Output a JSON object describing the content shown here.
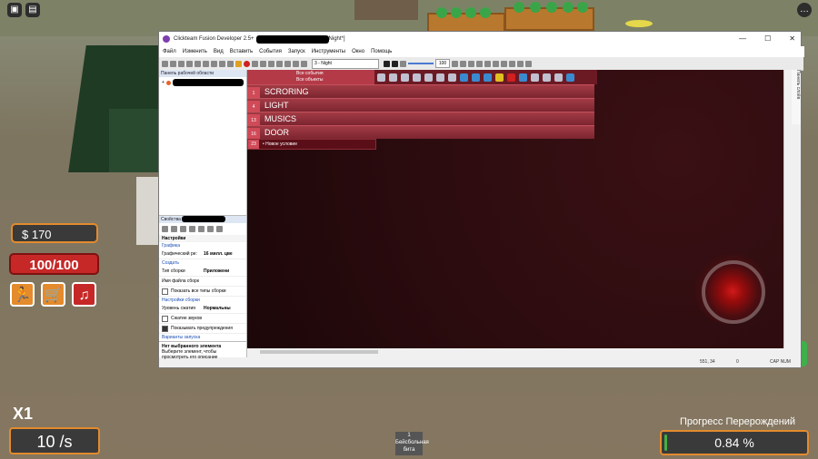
{
  "game": {
    "money": "$ 170",
    "health": "100/100",
    "buttons": [
      {
        "name": "run",
        "glyph": "🏃"
      },
      {
        "name": "shop",
        "glyph": "🛒"
      },
      {
        "name": "music",
        "glyph": "♫"
      }
    ],
    "multiplier": "X1",
    "rate": "10 /s",
    "rebirth_label": "Прогресс Перерождений",
    "rebirth_value": "0.84 %",
    "rebirth_fraction": 0.0084,
    "hotbar_slot_number": "1",
    "hotbar_slot_label": "Бейсбольная бита",
    "colors": {
      "accent": "#e38b2d",
      "health": "#c62828",
      "progress": "#43b043"
    }
  },
  "window": {
    "title_prefix": "Clickteam Fusion Developer 2.5+",
    "title_suffix": "Night*]",
    "buttons": {
      "minimize": "—",
      "maximize": "☐",
      "close": "✕"
    },
    "menu": [
      "Файл",
      "Изменить",
      "Вид",
      "Вставить",
      "События",
      "Запуск",
      "Инструменты",
      "Окно",
      "Помощь"
    ],
    "frame_select": "3 - Night",
    "zoom": "100",
    "workspace_title": "Панель рабочей области",
    "properties": {
      "title": "Свойства",
      "section": "Настройки",
      "categories": [
        "Графика",
        "Создать",
        "Настройки сборки",
        "Варианты запуска"
      ],
      "rows": [
        {
          "k": "Графический ре:",
          "v": "16 милл. цве"
        },
        {
          "k": "Тип сборки",
          "v": "Приложени"
        },
        {
          "k": "Имя файла сборк",
          "v": ""
        }
      ],
      "checks": [
        "Показать все типы сборки"
      ],
      "rows2": [
        {
          "k": "Уровень сжатия",
          "v": "Нормальны"
        }
      ],
      "checks2": [
        "Сжатие звуков",
        "Показывать предупреждения"
      ],
      "desc_title": "Нет выбранного элемента",
      "desc_text": "Выберите элемент, чтобы просмотреть его описание"
    },
    "event_editor": {
      "header_line1": "Все события",
      "header_line2": "Все объекты",
      "groups": [
        {
          "num": "1",
          "label": "SCRORING"
        },
        {
          "num": "4",
          "label": "LIGHT"
        },
        {
          "num": "13",
          "label": "MUSICS"
        },
        {
          "num": "16",
          "label": "DOOR"
        }
      ],
      "new_condition_num": "23",
      "new_condition_label": "• Новое условие"
    },
    "right_tab": "Панель слоёв",
    "status": {
      "coords": "551, 34",
      "zero": "0",
      "cap": "CAP NUM"
    }
  },
  "corner": {
    "left1": "▣",
    "left2": "▤",
    "right": "…"
  }
}
